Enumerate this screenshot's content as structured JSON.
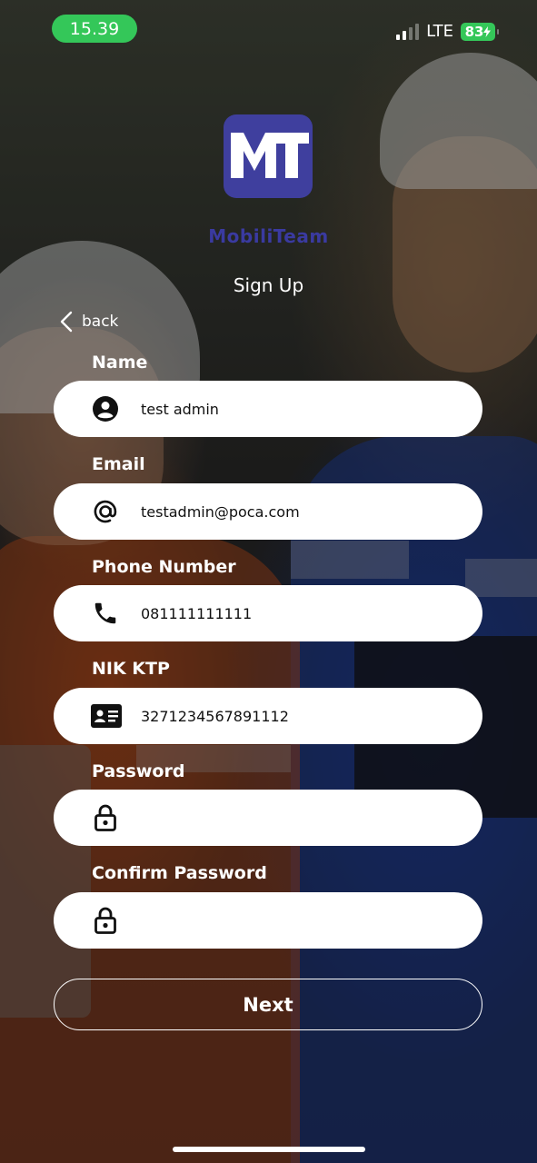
{
  "status_bar": {
    "time": "15.39",
    "network": "LTE",
    "battery": "83",
    "signal_bars": 4,
    "signal_active": 2
  },
  "app": {
    "brand": "MobiliTeam",
    "logo_icon": "mt-logo",
    "title": "Sign Up"
  },
  "nav": {
    "back_label": "back",
    "back_icon": "chevron-left-icon"
  },
  "form": {
    "name": {
      "label": "Name",
      "value": "test admin",
      "icon": "account-circle-icon"
    },
    "email": {
      "label": "Email",
      "value": "testadmin@poca.com",
      "icon": "at-sign-icon"
    },
    "phone": {
      "label": "Phone Number",
      "value": "081111111111",
      "icon": "phone-icon"
    },
    "nik": {
      "label": "NIK KTP",
      "value": "3271234567891112",
      "icon": "id-card-icon"
    },
    "password": {
      "label": "Password",
      "value": "",
      "icon": "lock-icon"
    },
    "confirm_password": {
      "label": "Confirm Password",
      "value": "",
      "icon": "lock-icon"
    }
  },
  "actions": {
    "next_label": "Next"
  },
  "colors": {
    "brand": "#3f3f9e",
    "status_green": "#34c759",
    "field_bg": "#ffffff",
    "text_dark": "#111111"
  }
}
